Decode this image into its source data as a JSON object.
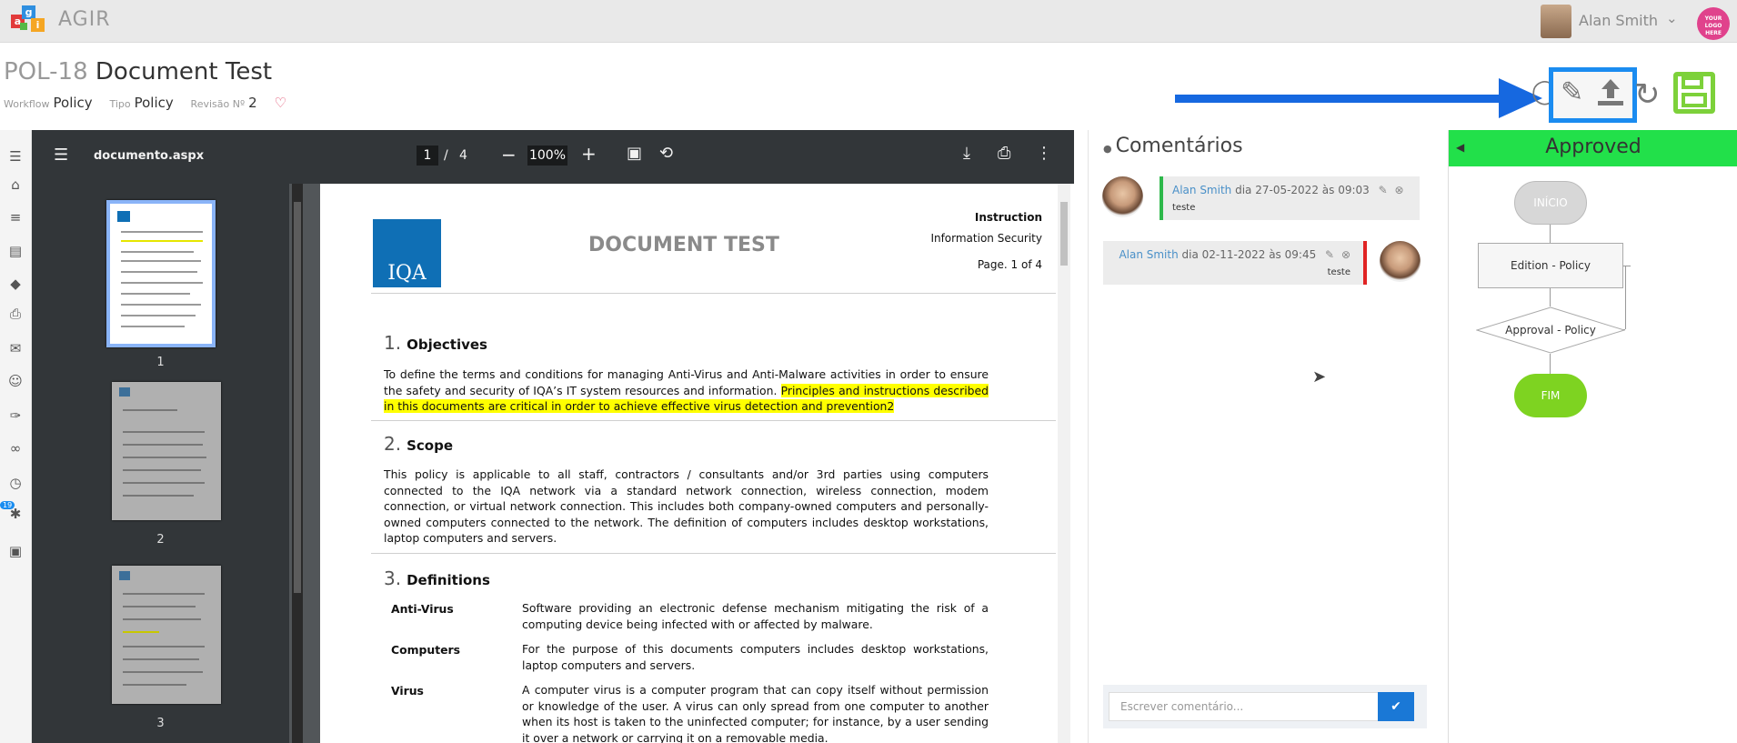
{
  "app": {
    "name": "AGIR",
    "user_name": "Alan Smith",
    "brand_logo_text": "YOUR LOGO HERE"
  },
  "document": {
    "code": "POL-18",
    "title": "Document Test",
    "meta": [
      {
        "label": "Workflow",
        "value": "Policy"
      },
      {
        "label": "Tipo",
        "value": "Policy"
      },
      {
        "label": "Revisão Nº",
        "value": "2"
      }
    ]
  },
  "toolbar": {
    "icons": [
      "pencil-icon",
      "upload-icon",
      "refresh-icon",
      "save-icon"
    ],
    "highlight_color": "#1b8cf0",
    "arrow_color": "#1668e0"
  },
  "sidebar": {
    "icons": [
      "menu-icon",
      "home-icon",
      "list-icon",
      "document-icon",
      "tag-icon",
      "print-icon",
      "mail-icon",
      "users-icon",
      "attachment-icon",
      "link-icon",
      "clock-icon",
      "person-icon",
      "archive-icon"
    ],
    "badge": "19"
  },
  "viewer": {
    "filename": "documento.aspx",
    "page_current": "1",
    "page_sep": "/",
    "page_total": "4",
    "zoom": "100%",
    "thumbs": [
      "1",
      "2",
      "3"
    ]
  },
  "page": {
    "org_logo": "IQA",
    "heading": "DOCUMENT TEST",
    "instruction": "Instruction",
    "department": "Information Security",
    "page_label": "Page. 1 of 4",
    "sections": [
      {
        "num": "1.",
        "title": "Objectives",
        "text": "To define the terms and conditions for managing Anti-Virus and Anti-Malware activities in order to ensure the safety and security of IQA’s IT system resources and information. ",
        "highlight": "Principles and instructions described in this documents are critical in order to achieve effective virus detection and prevention2"
      },
      {
        "num": "2.",
        "title": "Scope",
        "text": "This policy is applicable to all staff, contractors / consultants and/or 3rd parties using computers connected to the IQA network via a standard network connection, wireless connection, modem connection, or virtual network connection. This includes both company-owned computers and personally-owned computers connected to the network. The definition of computers includes desktop workstations, laptop computers and servers."
      },
      {
        "num": "3.",
        "title": "Definitions"
      }
    ],
    "definitions": [
      {
        "term": "Anti-Virus",
        "def": "Software providing an electronic defense mechanism mitigating the risk of a computing device being infected with or affected by malware."
      },
      {
        "term": "Computers",
        "def": "For the purpose of this documents computers includes desktop workstations, laptop computers and servers."
      },
      {
        "term": "Virus",
        "def": "A computer virus is a computer program that can copy itself without permission or knowledge of the user. A virus can only spread from one computer to another when its host is taken to the uninfected computer; for instance, by a user sending it over a network or carrying it on a removable media."
      }
    ]
  },
  "comments": {
    "title": "Comentários",
    "items": [
      {
        "author": "Alan Smith",
        "when": " dia 27-05-2022 às 09:03",
        "text": "teste",
        "accent": "#2db84a"
      },
      {
        "author": "Alan Smith",
        "when": " dia 02-11-2022 às 09:45",
        "text": "teste",
        "accent": "#e02424"
      }
    ],
    "placeholder": "Escrever comentário..."
  },
  "workflow": {
    "status": "Approved",
    "status_color": "#22e04a",
    "nodes": {
      "start": "INÍCIO",
      "edition": "Edition - Policy",
      "approval": "Approval - Policy",
      "end": "FIM"
    }
  }
}
